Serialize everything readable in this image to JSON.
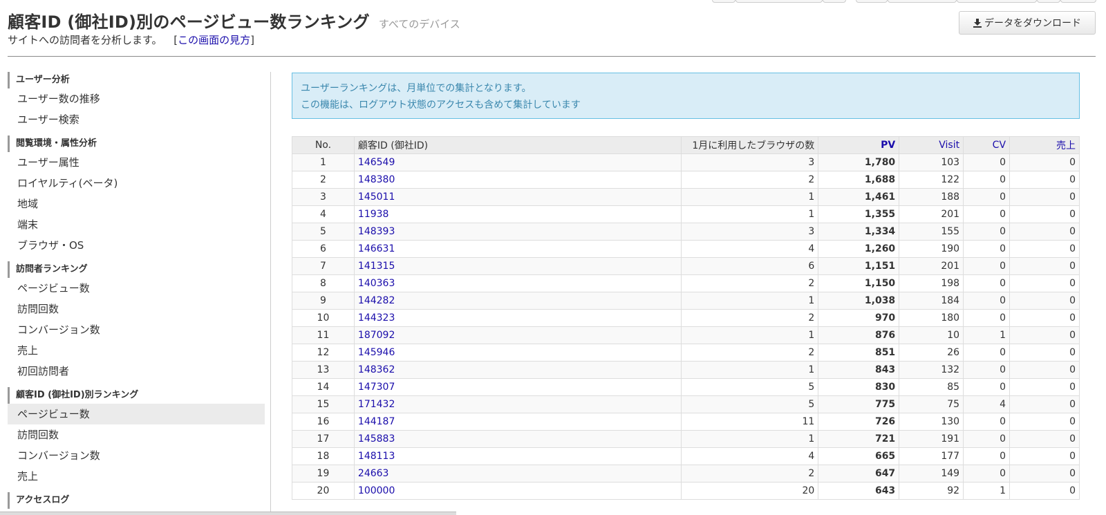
{
  "header": {
    "title": "顧客ID (御社ID)別のページビュー数ランキング",
    "device": "すべてのデバイス",
    "description": "サイトへの訪問者を分析します。",
    "help_link": "この画面の見方",
    "download_label": "データをダウンロード"
  },
  "sidebar": {
    "groups": [
      {
        "title": "ユーザー分析",
        "items": [
          "ユーザー数の推移",
          "ユーザー検索"
        ]
      },
      {
        "title": "閲覧環境・属性分析",
        "items": [
          "ユーザー属性",
          "ロイヤルティ(ベータ)",
          "地域",
          "端末",
          "ブラウザ・OS"
        ]
      },
      {
        "title": "訪問者ランキング",
        "items": [
          "ページビュー数",
          "訪問回数",
          "コンバージョン数",
          "売上",
          "初回訪問者"
        ]
      },
      {
        "title": "顧客ID (御社ID)別ランキング",
        "items": [
          "ページビュー数",
          "訪問回数",
          "コンバージョン数",
          "売上"
        ]
      },
      {
        "title": "アクセスログ",
        "items": []
      }
    ],
    "active": "ページビュー数"
  },
  "info": {
    "line1": "ユーザーランキングは、月単位での集計となります。",
    "line2": "この機能は、ログアウト状態のアクセスも含めて集計しています"
  },
  "table": {
    "headers": {
      "no": "No.",
      "id": "顧客ID (御社ID)",
      "browsers": "1月に利用したブラウザの数",
      "pv": "PV",
      "visit": "Visit",
      "cv": "CV",
      "sales": "売上"
    },
    "rows": [
      {
        "no": "1",
        "id": "146549",
        "browsers": "3",
        "pv": "1,780",
        "visit": "103",
        "cv": "0",
        "sales": "0"
      },
      {
        "no": "2",
        "id": "148380",
        "browsers": "2",
        "pv": "1,688",
        "visit": "122",
        "cv": "0",
        "sales": "0"
      },
      {
        "no": "3",
        "id": "145011",
        "browsers": "1",
        "pv": "1,461",
        "visit": "188",
        "cv": "0",
        "sales": "0"
      },
      {
        "no": "4",
        "id": "11938",
        "browsers": "1",
        "pv": "1,355",
        "visit": "201",
        "cv": "0",
        "sales": "0"
      },
      {
        "no": "5",
        "id": "148393",
        "browsers": "3",
        "pv": "1,334",
        "visit": "155",
        "cv": "0",
        "sales": "0"
      },
      {
        "no": "6",
        "id": "146631",
        "browsers": "4",
        "pv": "1,260",
        "visit": "190",
        "cv": "0",
        "sales": "0"
      },
      {
        "no": "7",
        "id": "141315",
        "browsers": "6",
        "pv": "1,151",
        "visit": "201",
        "cv": "0",
        "sales": "0"
      },
      {
        "no": "8",
        "id": "140363",
        "browsers": "2",
        "pv": "1,150",
        "visit": "198",
        "cv": "0",
        "sales": "0"
      },
      {
        "no": "9",
        "id": "144282",
        "browsers": "1",
        "pv": "1,038",
        "visit": "184",
        "cv": "0",
        "sales": "0"
      },
      {
        "no": "10",
        "id": "144323",
        "browsers": "2",
        "pv": "970",
        "visit": "180",
        "cv": "0",
        "sales": "0"
      },
      {
        "no": "11",
        "id": "187092",
        "browsers": "1",
        "pv": "876",
        "visit": "10",
        "cv": "1",
        "sales": "0"
      },
      {
        "no": "12",
        "id": "145946",
        "browsers": "2",
        "pv": "851",
        "visit": "26",
        "cv": "0",
        "sales": "0"
      },
      {
        "no": "13",
        "id": "148362",
        "browsers": "1",
        "pv": "843",
        "visit": "132",
        "cv": "0",
        "sales": "0"
      },
      {
        "no": "14",
        "id": "147307",
        "browsers": "5",
        "pv": "830",
        "visit": "85",
        "cv": "0",
        "sales": "0"
      },
      {
        "no": "15",
        "id": "171432",
        "browsers": "5",
        "pv": "775",
        "visit": "75",
        "cv": "4",
        "sales": "0"
      },
      {
        "no": "16",
        "id": "144187",
        "browsers": "11",
        "pv": "726",
        "visit": "130",
        "cv": "0",
        "sales": "0"
      },
      {
        "no": "17",
        "id": "145883",
        "browsers": "1",
        "pv": "721",
        "visit": "191",
        "cv": "0",
        "sales": "0"
      },
      {
        "no": "18",
        "id": "148113",
        "browsers": "4",
        "pv": "665",
        "visit": "177",
        "cv": "0",
        "sales": "0"
      },
      {
        "no": "19",
        "id": "24663",
        "browsers": "2",
        "pv": "647",
        "visit": "149",
        "cv": "0",
        "sales": "0"
      },
      {
        "no": "20",
        "id": "100000",
        "browsers": "20",
        "pv": "643",
        "visit": "92",
        "cv": "1",
        "sales": "0"
      }
    ]
  },
  "icons": {
    "download": "download-icon"
  }
}
